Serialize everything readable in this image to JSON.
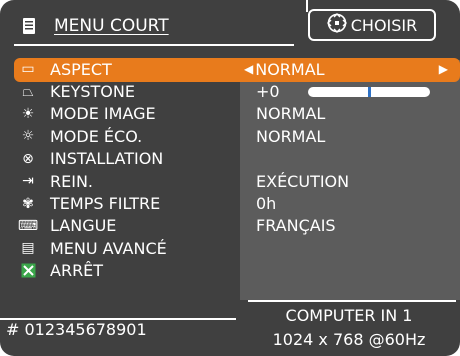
{
  "header": {
    "title": "MENU COURT",
    "hint": "CHOISIR"
  },
  "menu": {
    "items": [
      {
        "label": "ASPECT",
        "icon": "aspect-icon",
        "glyph": "▭"
      },
      {
        "label": "KEYSTONE",
        "icon": "keystone-icon",
        "glyph": "⏢"
      },
      {
        "label": "MODE IMAGE",
        "icon": "image-mode-icon",
        "glyph": "☀"
      },
      {
        "label": "MODE ÉCO.",
        "icon": "eco-mode-icon",
        "glyph": "☼"
      },
      {
        "label": "INSTALLATION",
        "icon": "installation-icon",
        "glyph": "⊗"
      },
      {
        "label": "REIN.",
        "icon": "reset-icon",
        "glyph": "⇥"
      },
      {
        "label": "TEMPS FILTRE",
        "icon": "filter-time-icon",
        "glyph": "✾"
      },
      {
        "label": "LANGUE",
        "icon": "language-icon",
        "glyph": "⌨"
      },
      {
        "label": "MENU AVANCÉ",
        "icon": "advanced-menu-icon",
        "glyph": "▤"
      },
      {
        "label": "ARRÊT",
        "icon": "stop-icon",
        "glyph": "✕"
      }
    ]
  },
  "values": {
    "aspect": "NORMAL",
    "keystone_value": "+0",
    "keystone_level": 0.5,
    "mode_image": "NORMAL",
    "mode_eco": "NORMAL",
    "installation": "",
    "reset": "EXÉCUTION",
    "filter_time": "0h",
    "language": "FRANÇAIS"
  },
  "footer": {
    "serial": "# 012345678901",
    "source": "COMPUTER IN 1",
    "resolution": "1024 x 768 @60Hz"
  },
  "colors": {
    "background": "#404040",
    "panel": "#5c5c5c",
    "selection": "#e87b1c",
    "slider_fill": "#2e72c6"
  }
}
